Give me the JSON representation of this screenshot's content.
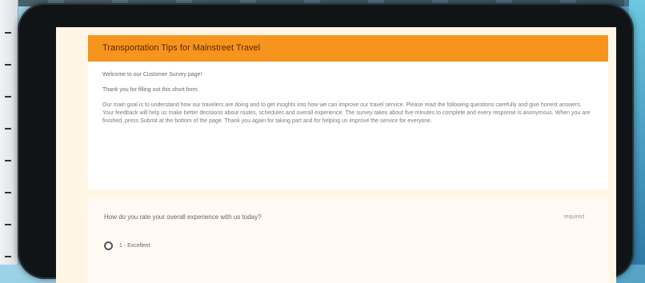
{
  "survey": {
    "header_title": "Transportation Tips for Mainstreet Travel",
    "intro_lines": [
      "Welcome to our Customer Survey page!",
      "Thank you for filling out this short form."
    ],
    "body_text": "Our main goal is to understand how our travelers are doing and to get insights into how we can improve our travel service. Please read the following questions carefully and give honest answers. Your feedback will help us make better decisions about routes, schedules and overall experience. The survey takes about five minutes to complete and every response is anonymous. When you are finished, press Submit at the bottom of the page. Thank you again for taking part and for helping us improve the service for everyone."
  },
  "question": {
    "text": "How do you rate your overall experience with us today?",
    "required_label": "required",
    "options": [
      "1 - Excellent"
    ]
  }
}
